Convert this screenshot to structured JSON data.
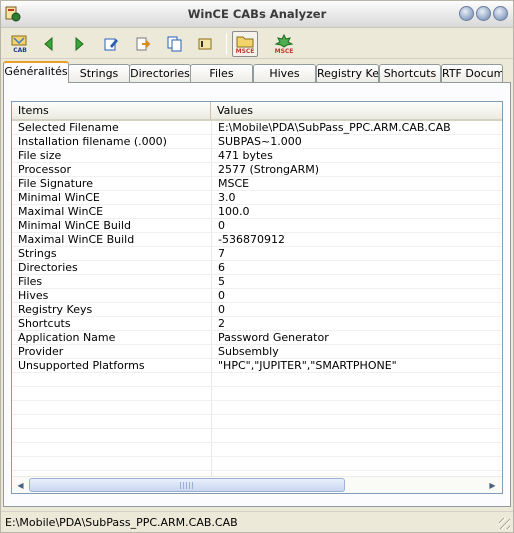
{
  "window": {
    "title": "WinCE CABs Analyzer"
  },
  "toolbar": {
    "buttons": [
      {
        "name": "open-cab-icon",
        "label": "CAB"
      },
      {
        "name": "back-arrow-icon",
        "label": ""
      },
      {
        "name": "forward-arrow-icon",
        "label": ""
      },
      {
        "name": "edit-icon",
        "label": ""
      },
      {
        "name": "export-icon",
        "label": ""
      },
      {
        "name": "copy-icon",
        "label": ""
      },
      {
        "name": "info-icon",
        "label": ""
      },
      {
        "name": "msce-folder-icon",
        "label": "MSCE"
      },
      {
        "name": "msce-run-icon",
        "label": "MSCE"
      }
    ]
  },
  "tabs": [
    {
      "label": "Généralités",
      "selected": true
    },
    {
      "label": "Strings"
    },
    {
      "label": "Directories"
    },
    {
      "label": "Files"
    },
    {
      "label": "Hives"
    },
    {
      "label": "Registry Keys"
    },
    {
      "label": "Shortcuts"
    },
    {
      "label": "RTF Document"
    }
  ],
  "table": {
    "headers": [
      "Items",
      "Values"
    ],
    "rows": [
      [
        "Selected Filename",
        "E:\\Mobile\\PDA\\SubPass_PPC.ARM.CAB.CAB"
      ],
      [
        "Installation filename (.000)",
        "SUBPAS~1.000"
      ],
      [
        "File size",
        "471 bytes"
      ],
      [
        "Processor",
        "2577 (StrongARM)"
      ],
      [
        "File Signature",
        "MSCE"
      ],
      [
        "Minimal WinCE",
        "3.0"
      ],
      [
        "Maximal WinCE",
        "100.0"
      ],
      [
        "Minimal WinCE Build",
        "0"
      ],
      [
        "Maximal WinCE Build",
        "-536870912"
      ],
      [
        "Strings",
        "7"
      ],
      [
        "Directories",
        "6"
      ],
      [
        "Files",
        "5"
      ],
      [
        "Hives",
        "0"
      ],
      [
        "Registry Keys",
        "0"
      ],
      [
        "Shortcuts",
        "2"
      ],
      [
        "Application Name",
        "Password Generator"
      ],
      [
        "Provider",
        "Subsembly"
      ],
      [
        "Unsupported Platforms",
        "\"HPC\",\"JUPITER\",\"SMARTPHONE\""
      ]
    ],
    "empty_rows": 7
  },
  "statusbar": {
    "text": "E:\\Mobile\\PDA\\SubPass_PPC.ARM.CAB.CAB"
  },
  "colors": {
    "tab_accent": "#e5a02b",
    "face": "#ece9d8",
    "list_border": "#7f9db9"
  }
}
